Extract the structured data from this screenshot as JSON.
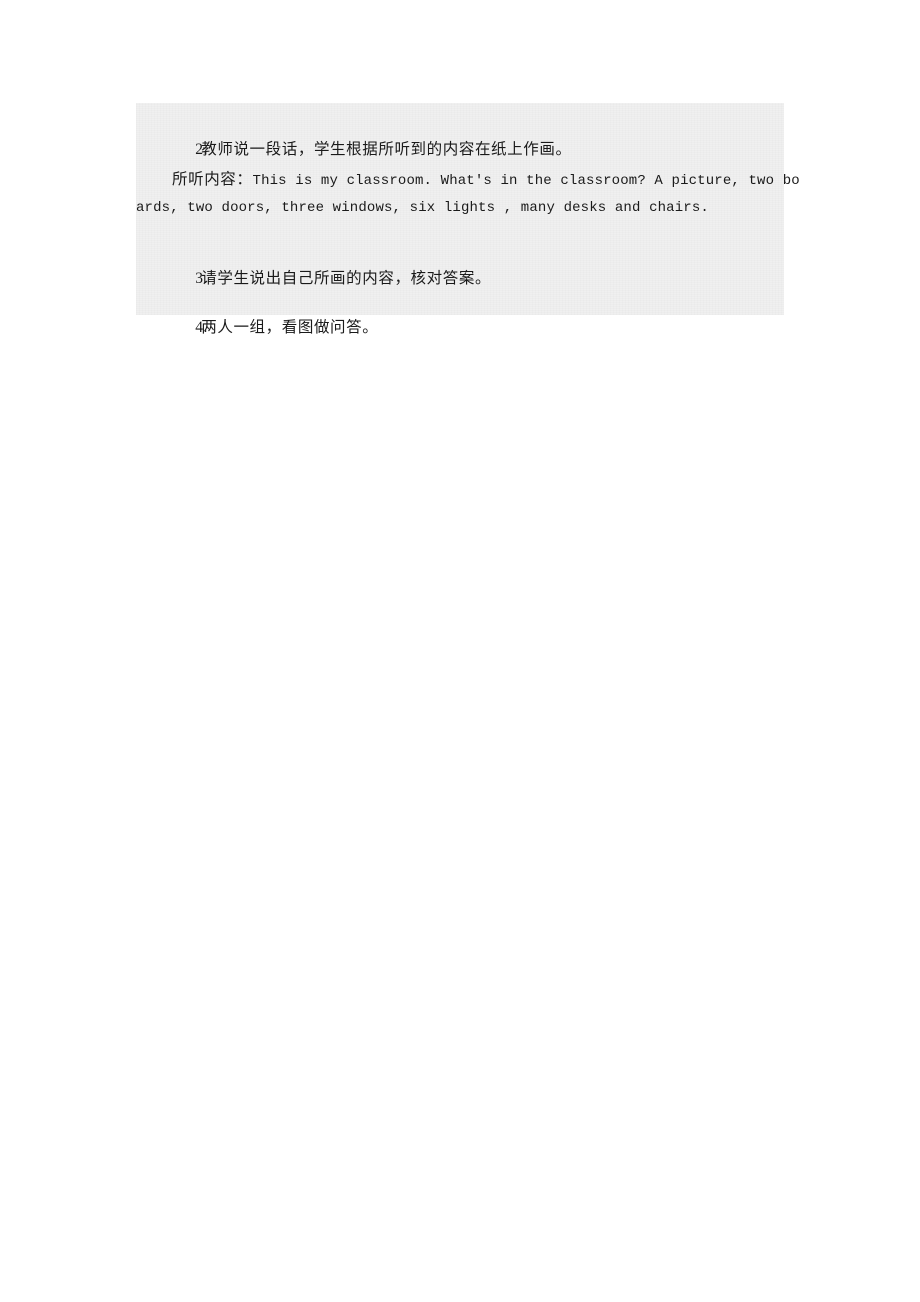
{
  "document": {
    "page_background": "#ffffff",
    "block_background": "#f0f0f0",
    "text_color": "#1a1a1a",
    "items": [
      {
        "number": "2.",
        "text": "教师说一段话，学生根据所听到的内容在纸上作画。"
      },
      {
        "number": "3.",
        "text": "请学生说出自己所画的内容，核对答案。"
      },
      {
        "number": "4.",
        "text": "两人一组，看图做问答。"
      }
    ],
    "passage": {
      "label": "所听内容：",
      "line1_english": "This is my classroom. What's in the classroom? A picture, two bo",
      "line2_english": "ards, two doors, three windows, six lights , many desks and chairs.",
      "full_english": "This is my classroom. What's in the classroom? A picture, two boards, two doors, three windows, six lights , many desks and chairs."
    }
  }
}
